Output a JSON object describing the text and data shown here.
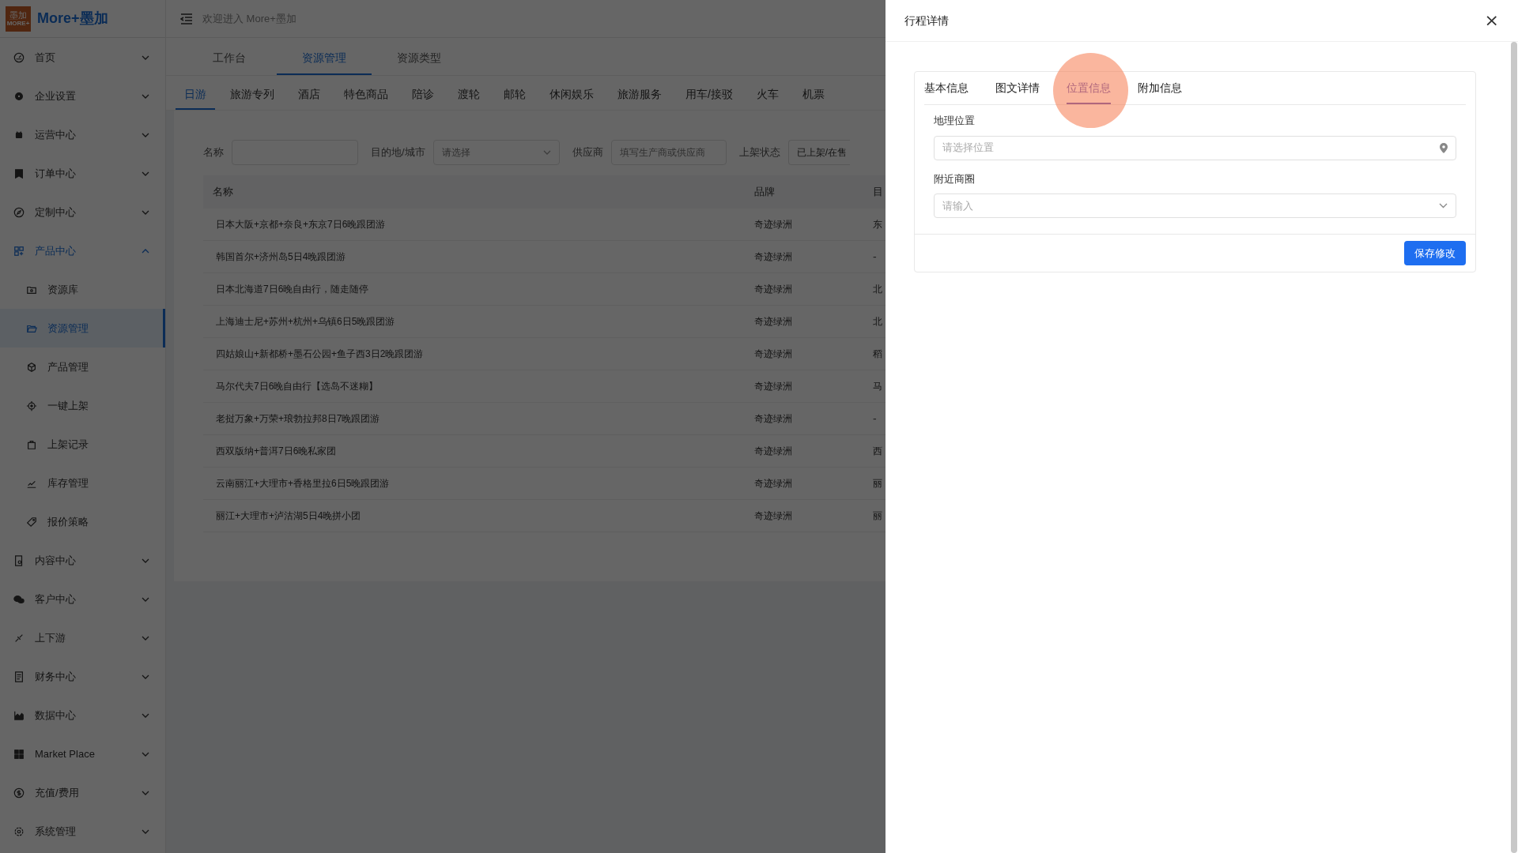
{
  "app": {
    "logo_text": "墨加",
    "logo_sub": "MORE+",
    "name": "More+墨加"
  },
  "header": {
    "welcome": "欢迎进入 More+墨加"
  },
  "sidebar": {
    "items": [
      {
        "label": "首页",
        "expanded": false,
        "selected": false
      },
      {
        "label": "企业设置",
        "expanded": false,
        "selected": false
      },
      {
        "label": "运营中心",
        "expanded": false,
        "selected": false
      },
      {
        "label": "订单中心",
        "expanded": false,
        "selected": false
      },
      {
        "label": "定制中心",
        "expanded": false,
        "selected": false
      },
      {
        "label": "产品中心",
        "expanded": true,
        "selected": true,
        "children": [
          {
            "label": "资源库",
            "selected": false
          },
          {
            "label": "资源管理",
            "selected": true
          },
          {
            "label": "产品管理",
            "selected": false
          },
          {
            "label": "一键上架",
            "selected": false
          },
          {
            "label": "上架记录",
            "selected": false
          },
          {
            "label": "库存管理",
            "selected": false
          },
          {
            "label": "报价策略",
            "selected": false
          }
        ]
      },
      {
        "label": "内容中心",
        "expanded": false,
        "selected": false
      },
      {
        "label": "客户中心",
        "expanded": false,
        "selected": false
      },
      {
        "label": "上下游",
        "expanded": false,
        "selected": false
      },
      {
        "label": "财务中心",
        "expanded": false,
        "selected": false
      },
      {
        "label": "数据中心",
        "expanded": false,
        "selected": false
      },
      {
        "label": "Market Place",
        "expanded": false,
        "selected": false
      },
      {
        "label": "充值/费用",
        "expanded": false,
        "selected": false
      },
      {
        "label": "系统管理",
        "expanded": false,
        "selected": false
      }
    ]
  },
  "page_tabs": [
    {
      "label": "工作台",
      "selected": false
    },
    {
      "label": "资源管理",
      "selected": true
    },
    {
      "label": "资源类型",
      "selected": false
    }
  ],
  "category_tabs": [
    {
      "label": "日游",
      "selected": true
    },
    {
      "label": "旅游专列",
      "selected": false
    },
    {
      "label": "酒店",
      "selected": false
    },
    {
      "label": "特色商品",
      "selected": false
    },
    {
      "label": "陪诊",
      "selected": false
    },
    {
      "label": "渡轮",
      "selected": false
    },
    {
      "label": "邮轮",
      "selected": false
    },
    {
      "label": "休闲娱乐",
      "selected": false
    },
    {
      "label": "旅游服务",
      "selected": false
    },
    {
      "label": "用车/接驳",
      "selected": false
    },
    {
      "label": "火车",
      "selected": false
    },
    {
      "label": "机票",
      "selected": false
    }
  ],
  "filters": {
    "name_label": "名称",
    "city_label": "目的地/城市",
    "city_placeholder": "请选择",
    "supplier_label": "供应商",
    "supplier_placeholder": "填写生产商或供应商",
    "status_label": "上架状态",
    "status_value": "已上架/在售"
  },
  "table": {
    "columns": [
      "名称",
      "品牌",
      "目"
    ],
    "rows": [
      [
        "日本大阪+京都+奈良+东京7日6晚跟团游",
        "奇迹绿洲",
        "东"
      ],
      [
        "韩国首尔+济州岛5日4晚跟团游",
        "奇迹绿洲",
        "-"
      ],
      [
        "日本北海道7日6晚自由行，随走随停",
        "奇迹绿洲",
        "北"
      ],
      [
        "上海迪士尼+苏州+杭州+乌镇6日5晚跟团游",
        "奇迹绿洲",
        "北"
      ],
      [
        "四姑娘山+新都桥+墨石公园+鱼子西3日2晚跟团游",
        "奇迹绿洲",
        "稻"
      ],
      [
        "马尔代夫7日6晚自由行【选岛不迷糊】",
        "奇迹绿洲",
        "马"
      ],
      [
        "老挝万象+万荣+琅勃拉邦8日7晚跟团游",
        "奇迹绿洲",
        "-"
      ],
      [
        "西双版纳+普洱7日6晚私家团",
        "奇迹绿洲",
        "西"
      ],
      [
        "云南丽江+大理市+香格里拉6日5晚跟团游",
        "奇迹绿洲",
        "丽"
      ],
      [
        "丽江+大理市+泸沽湖5日4晚拼小团",
        "奇迹绿洲",
        "丽"
      ]
    ]
  },
  "drawer": {
    "title": "行程详情",
    "close": "×",
    "tabs": [
      {
        "label": "基本信息",
        "selected": false
      },
      {
        "label": "图文详情",
        "selected": false
      },
      {
        "label": "位置信息",
        "selected": true
      },
      {
        "label": "附加信息",
        "selected": false
      }
    ],
    "fields": [
      {
        "kind": "location",
        "label": "地理位置",
        "placeholder": "请选择位置"
      },
      {
        "kind": "select",
        "label": "附近商圈",
        "placeholder": "请输入"
      }
    ],
    "save_button": "保存修改"
  }
}
